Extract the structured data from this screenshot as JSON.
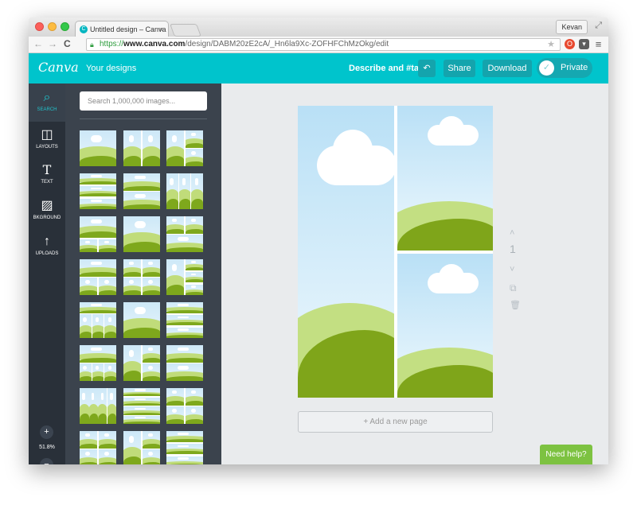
{
  "browser": {
    "tab_title": "Untitled design – Canva",
    "tab_close": "×",
    "favicon_letter": "C",
    "user": "Kevan",
    "url_scheme": "https://",
    "url_host": "www.canva.com",
    "url_path": "/design/DABM20zE2cA/_Hn6la9Xc-ZOFHFChMzOkg/edit",
    "nav_back": "←",
    "nav_forward": "→",
    "reload": "C",
    "menu_glyph": "≡"
  },
  "header": {
    "logo": "Canva",
    "your_designs": "Your designs",
    "describe": "Describe and #tag",
    "undo_glyph": "↶",
    "share": "Share",
    "download": "Download",
    "private": "Private",
    "check_glyph": "✓"
  },
  "sidebar": {
    "items": [
      {
        "label": "SEARCH",
        "glyph": "⌕"
      },
      {
        "label": "LAYOUTS",
        "glyph": "◫"
      },
      {
        "label": "TEXT",
        "glyph": "T"
      },
      {
        "label": "BKGROUND",
        "glyph": "▨"
      },
      {
        "label": "UPLOADS",
        "glyph": "↑"
      }
    ],
    "zoom_in": "+",
    "zoom_level": "51.8%",
    "zoom_out": "−"
  },
  "panel": {
    "search_placeholder": "Search 1,000,000 images..."
  },
  "canvas": {
    "page_number": "1",
    "add_page": "+ Add a new page",
    "need_help": "Need help?"
  },
  "colors": {
    "brand": "#00c4cc",
    "sidebar": "#293039",
    "panel": "#3b434d",
    "help": "#7dc241"
  }
}
